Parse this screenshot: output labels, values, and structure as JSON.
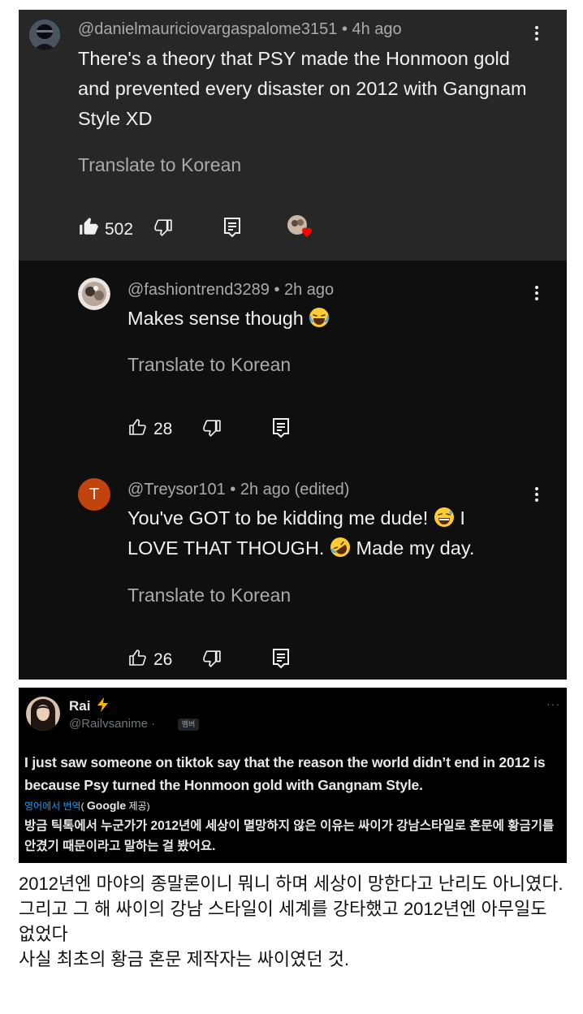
{
  "comments": [
    {
      "handle": "@danielmauriciovargaspalome3151",
      "time": "4h ago",
      "text": "There's a theory that PSY made the Honmoon gold and prevented every disaster on 2012 with Gangnam Style XD",
      "translate": "Translate to Korean",
      "likes": "502"
    },
    {
      "handle": "@fashiontrend3289",
      "time": "2h ago",
      "text": "Makes sense though",
      "translate": "Translate to Korean",
      "likes": "28"
    },
    {
      "handle": "@Treysor101",
      "time": "2h ago (edited)",
      "avatar_letter": "T",
      "text_1": "You've GOT to be kidding me dude!",
      "text_2": "I",
      "text_3": "LOVE THAT THOUGH.",
      "text_4": "Made my day.",
      "translate": "Translate to Korean",
      "likes": "26"
    }
  ],
  "tweet": {
    "name": "Rai",
    "handle": "@Railvsanime",
    "badge": "멤버",
    "more": "···",
    "text": "I just saw someone on tiktok say that the reason the world didn’t end in 2012 is because Psy turned the Honmoon gold with Gangnam Style.",
    "translate_link": "영어에서 번역",
    "translate_google": "Google",
    "translate_suffix": "제공)",
    "translated": "방금 틱톡에서 누군가가 2012년에 세상이 멸망하지 않은 이유는 싸이가 강남스타일로 혼문에 황금기를 안겼기 때문이라고 말하는 걸 봤어요."
  },
  "caption": [
    "2012년엔 마야의 종말론이니 뭐니 하며 세상이 망한다고 난리도 아니였다.",
    "그리고 그 해 싸이의 강남 스타일이 세계를 강타했고 2012년엔 아무일도 없었다",
    "사실 최초의 황금 혼문 제작자는 싸이였던 것."
  ],
  "colors": {
    "top_comment_bg": "#272727",
    "reply_bg": "#0f0f0f",
    "avatar_t": "#c1440e",
    "link_blue": "#1d9bf0",
    "heart": "#ff0000"
  },
  "icons": [
    "thumbs-up-filled-icon",
    "thumbs-down-icon",
    "reply-icon",
    "creator-heart-icon",
    "thumbs-up-outline-icon",
    "more-vert-icon",
    "laughing-emoji-icon",
    "sweat-smile-emoji-icon",
    "rofl-emoji-icon",
    "lightning-icon"
  ]
}
